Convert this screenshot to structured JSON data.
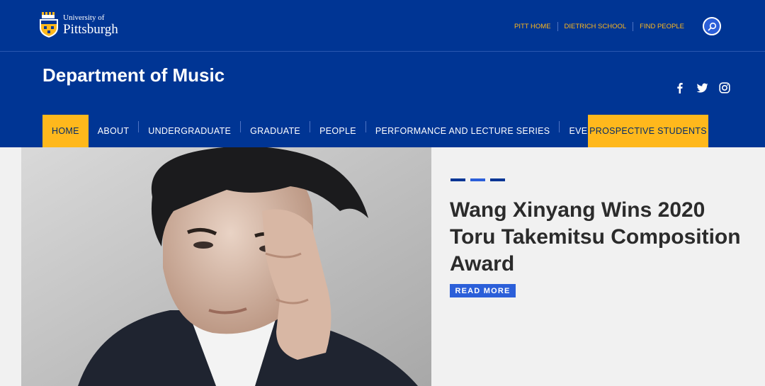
{
  "header": {
    "logo": {
      "line1": "University of",
      "line2": "Pittsburgh"
    },
    "top_links": [
      "PITT HOME",
      "DIETRICH SCHOOL",
      "FIND PEOPLE"
    ],
    "search_icon": "search-icon",
    "department": "Department of Music",
    "social_icons": [
      "facebook-icon",
      "twitter-icon",
      "instagram-icon"
    ]
  },
  "nav": {
    "items": [
      "HOME",
      "ABOUT",
      "UNDERGRADUATE",
      "GRADUATE",
      "PEOPLE",
      "PERFORMANCE AND LECTURE SERIES",
      "EVENTS"
    ],
    "active": "HOME",
    "cta": "PROSPECTIVE STUDENTS"
  },
  "feature": {
    "title": "Wang Xinyang Wins 2020 Toru Takemitsu Composition Award",
    "read_more": "READ MORE",
    "dash_colors": [
      "#003594",
      "#2b5fd9",
      "#003594"
    ]
  },
  "colors": {
    "brand_blue": "#003594",
    "gold": "#ffb81c",
    "accent_blue": "#2b5fd9",
    "text_dark": "#2b2b2b"
  }
}
